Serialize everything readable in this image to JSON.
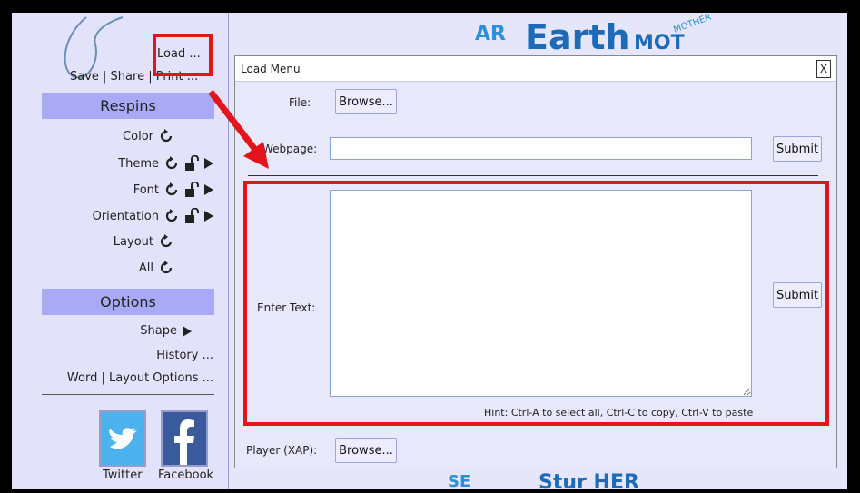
{
  "sidebar": {
    "load_label": "Load ...",
    "save_row": "Save | Share | Print ...",
    "respins_header": "Respins",
    "respins": [
      {
        "label": "Color",
        "lock": false,
        "arrow": false
      },
      {
        "label": "Theme",
        "lock": true,
        "arrow": true
      },
      {
        "label": "Font",
        "lock": true,
        "arrow": true
      },
      {
        "label": "Orientation",
        "lock": true,
        "arrow": true
      },
      {
        "label": "Layout",
        "lock": false,
        "arrow": false
      },
      {
        "label": "All",
        "lock": false,
        "arrow": false
      }
    ],
    "options_header": "Options",
    "shape_label": "Shape",
    "history_label": "History ...",
    "word_layout_label": "Word | Layout Options ...",
    "twitter_label": "Twitter",
    "facebook_label": "Facebook"
  },
  "dialog": {
    "title": "Load Menu",
    "close_label": "X",
    "file_label": "File:",
    "browse_label": "Browse...",
    "webpage_label": "Webpage:",
    "webpage_value": "",
    "submit_label": "Submit",
    "enter_text_label": "Enter Text:",
    "enter_text_value": "",
    "hint": "Hint: Ctrl-A to select all, Ctrl-C to copy, Ctrl-V to paste",
    "player_label": "Player (XAP):",
    "player_browse_label": "Browse..."
  },
  "colors": {
    "accent_red": "#e3141b",
    "header_purple": "#a9a9f6",
    "twitter_blue": "#4bb2ee",
    "facebook_blue": "#3a5a9b"
  }
}
